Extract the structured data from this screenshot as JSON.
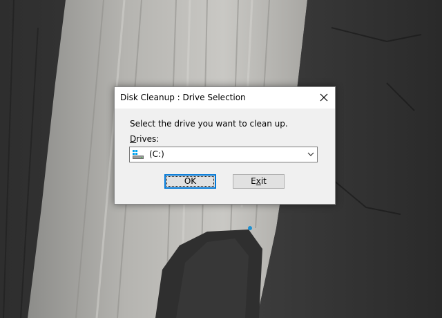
{
  "dialog": {
    "title": "Disk Cleanup : Drive Selection",
    "instruction": "Select the drive you want to clean up.",
    "drives_label_mnemonic": "D",
    "drives_label_rest": "rives:",
    "selected_drive": "(C:)",
    "ok_label_mnemonic": "",
    "ok_label": "OK",
    "exit_label_pre": "E",
    "exit_label_mnemonic": "x",
    "exit_label_post": "it"
  },
  "icons": {
    "close": "close-icon",
    "drive": "hard-drive-icon",
    "dropdown": "chevron-down-icon"
  },
  "colors": {
    "dialog_bg": "#f0f0f0",
    "titlebar_bg": "#ffffff",
    "focus_border": "#0078d7",
    "button_bg": "#e1e1e1"
  }
}
